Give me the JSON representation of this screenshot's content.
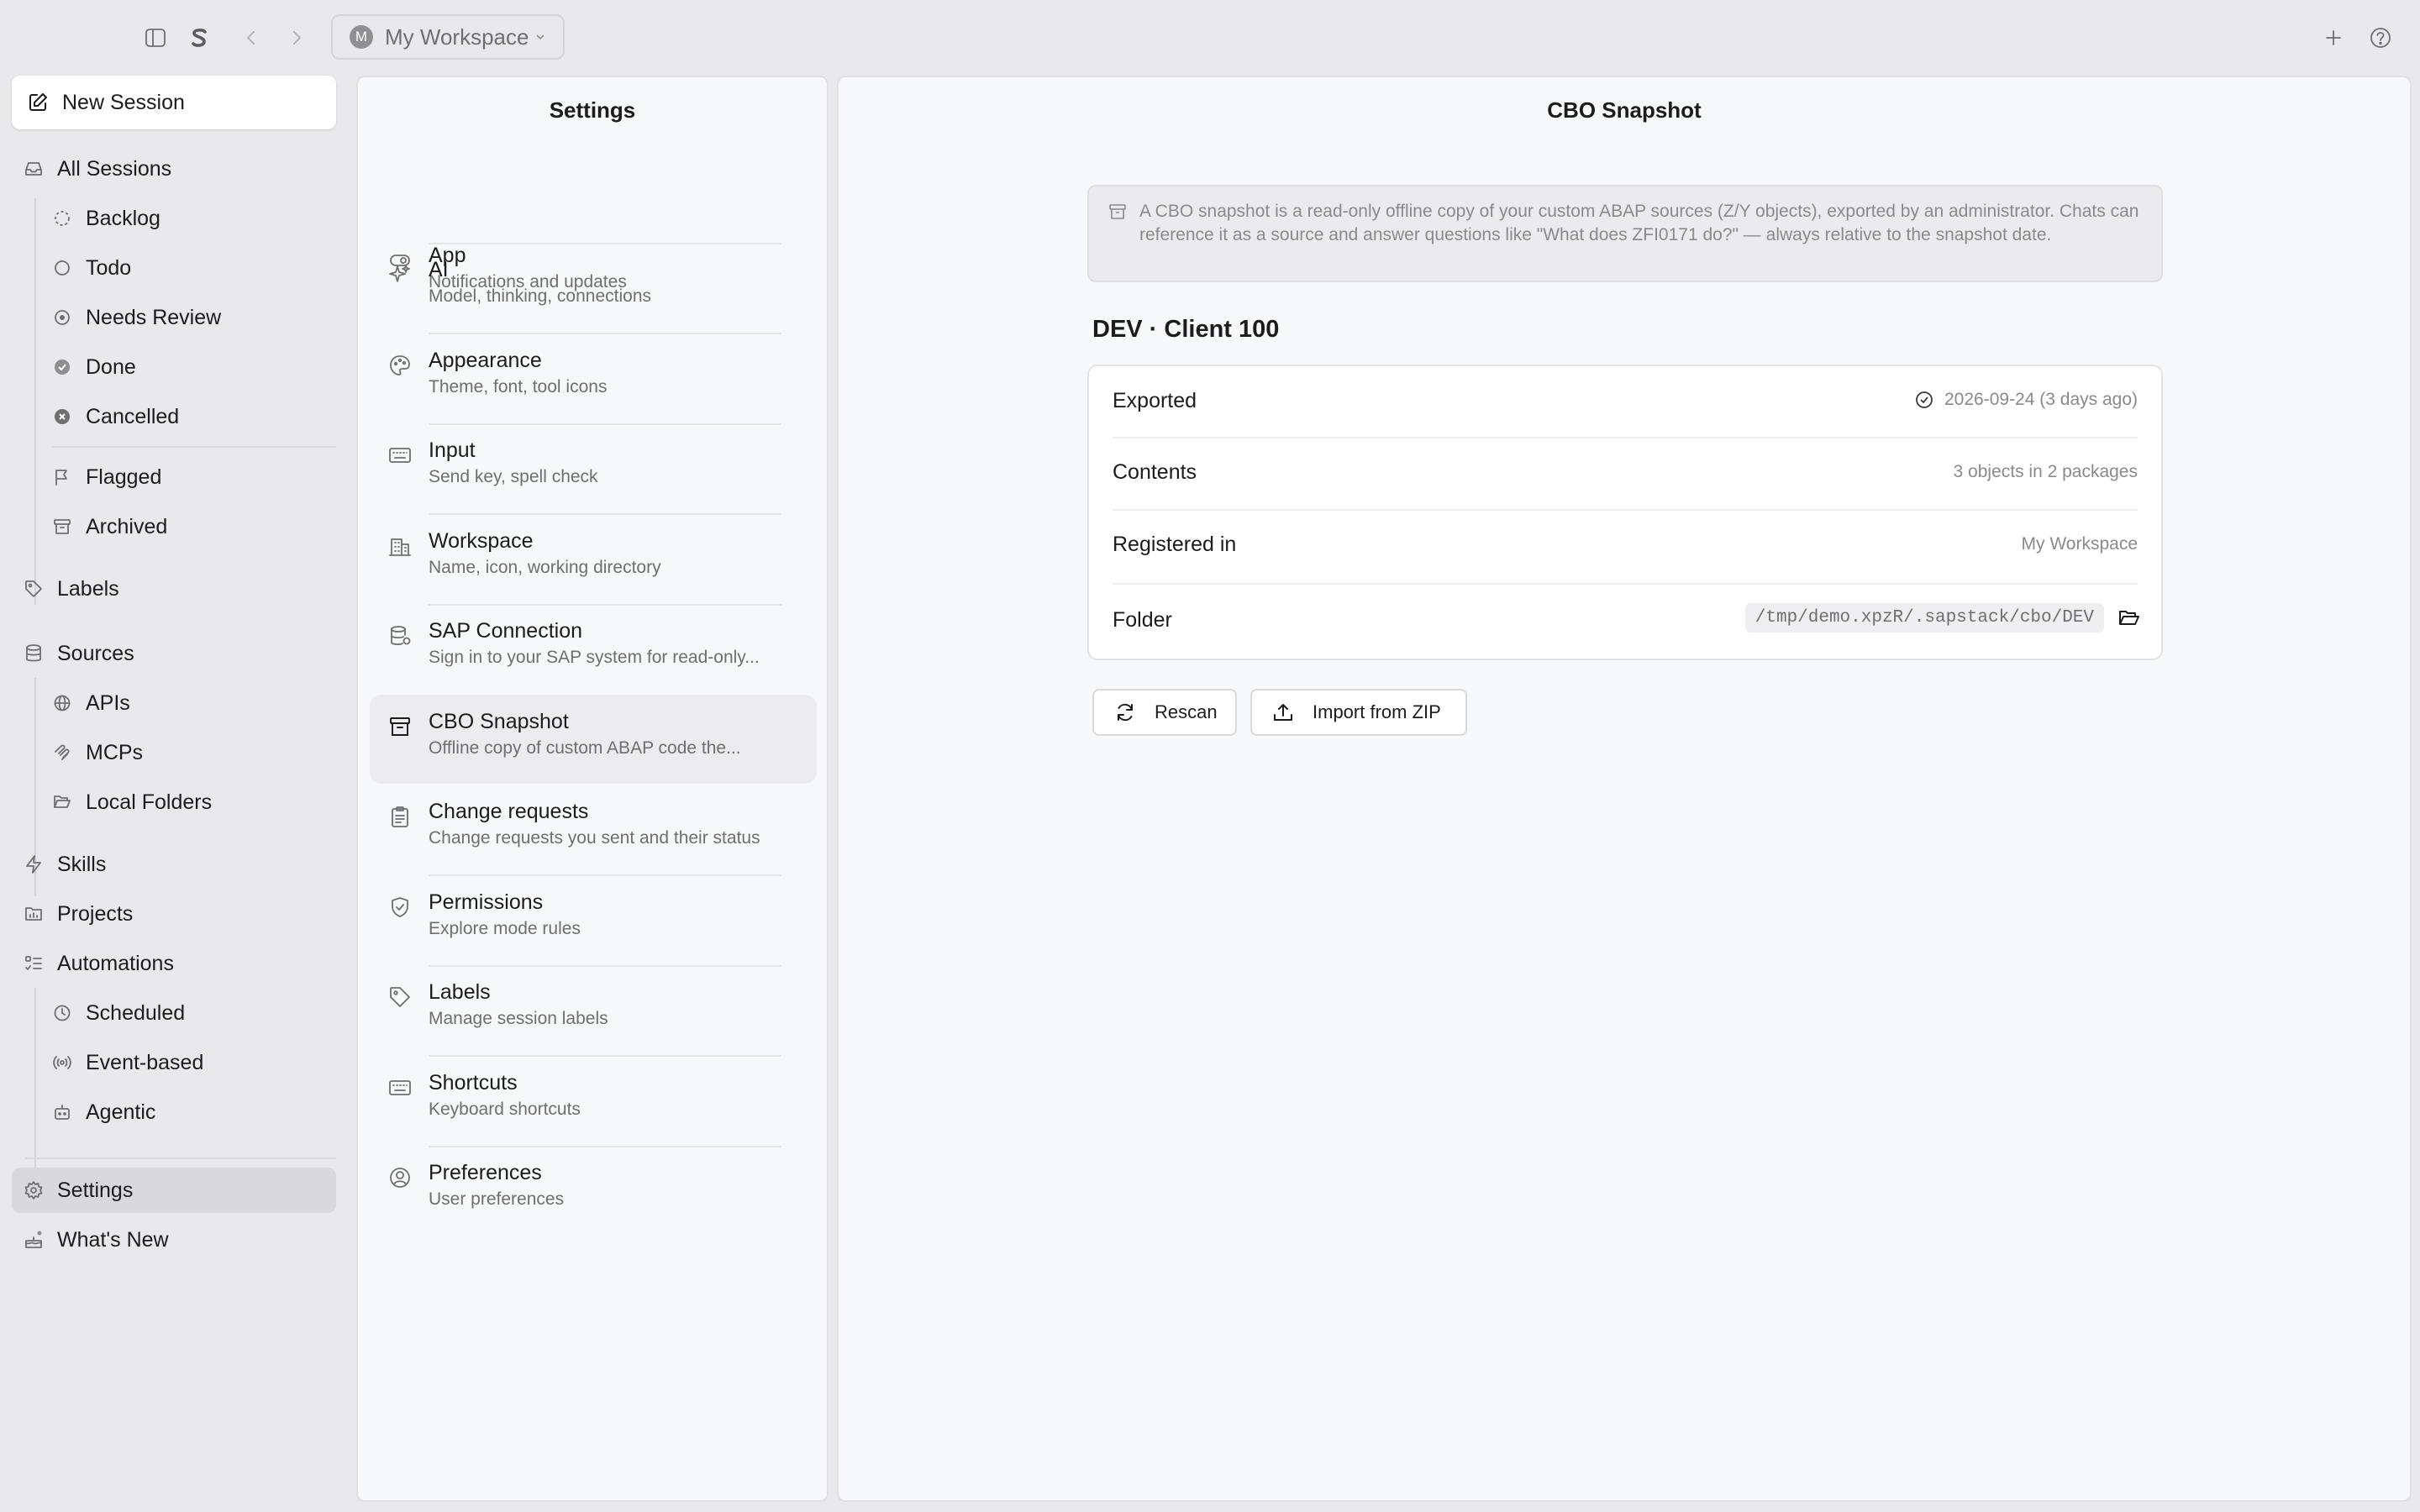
{
  "topbar": {
    "workspace_avatar": "M",
    "workspace_name": "My Workspace",
    "icons": [
      "sidebar-toggle-icon",
      "s-logo-icon",
      "chevron-left-icon",
      "chevron-right-icon",
      "plus-icon",
      "help-icon"
    ]
  },
  "sidebar": {
    "new_session": "New Session",
    "all_sessions": "All Sessions",
    "session_filters": [
      "Backlog",
      "Todo",
      "Needs Review",
      "Done",
      "Cancelled"
    ],
    "flagged": "Flagged",
    "archived": "Archived",
    "labels": "Labels",
    "sources": "Sources",
    "source_items": [
      "APIs",
      "MCPs",
      "Local Folders"
    ],
    "skills": "Skills",
    "projects": "Projects",
    "automations": "Automations",
    "automation_items": [
      "Scheduled",
      "Event-based",
      "Agentic"
    ],
    "settings": "Settings",
    "whats_new": "What's New"
  },
  "settings_panel": {
    "title": "Settings",
    "items": [
      {
        "title": "App",
        "subtitle": "Notifications and updates",
        "icon": "toggle-icon"
      },
      {
        "title": "AI",
        "subtitle": "Model, thinking, connections",
        "icon": "sparkles-icon"
      },
      {
        "title": "Appearance",
        "subtitle": "Theme, font, tool icons",
        "icon": "palette-icon"
      },
      {
        "title": "Input",
        "subtitle": "Send key, spell check",
        "icon": "keyboard-icon"
      },
      {
        "title": "Workspace",
        "subtitle": "Name, icon, working directory",
        "icon": "building-icon"
      },
      {
        "title": "SAP Connection",
        "subtitle": "Sign in to your SAP system for read-only...",
        "icon": "database-icon"
      },
      {
        "title": "CBO Snapshot",
        "subtitle": "Offline copy of custom ABAP code the...",
        "icon": "archive-icon",
        "active": true
      },
      {
        "title": "Change requests",
        "subtitle": "Change requests you sent and their status",
        "icon": "clipboard-icon"
      },
      {
        "title": "Permissions",
        "subtitle": "Explore mode rules",
        "icon": "shield-icon"
      },
      {
        "title": "Labels",
        "subtitle": "Manage session labels",
        "icon": "tag-icon"
      },
      {
        "title": "Shortcuts",
        "subtitle": "Keyboard shortcuts",
        "icon": "keyboard-icon"
      },
      {
        "title": "Preferences",
        "subtitle": "User preferences",
        "icon": "user-circle-icon"
      }
    ]
  },
  "main": {
    "title": "CBO Snapshot",
    "info": "A CBO snapshot is a read-only offline copy of your custom ABAP sources (Z/Y objects), exported by an administrator. Chats can reference it as a source and answer questions like \"What does ZFI0171 do?\" — always relative to the snapshot date.",
    "section_title": "DEV · Client 100",
    "rows": {
      "exported_label": "Exported",
      "exported_value": "2026-09-24 (3 days ago)",
      "contents_label": "Contents",
      "contents_value": "3 objects in 2 packages",
      "registered_label": "Registered in",
      "registered_value": "My Workspace",
      "folder_label": "Folder",
      "folder_value": "/tmp/demo.xpzR/.sapstack/cbo/DEV"
    },
    "rescan_button": "Rescan",
    "import_button": "Import from ZIP"
  }
}
